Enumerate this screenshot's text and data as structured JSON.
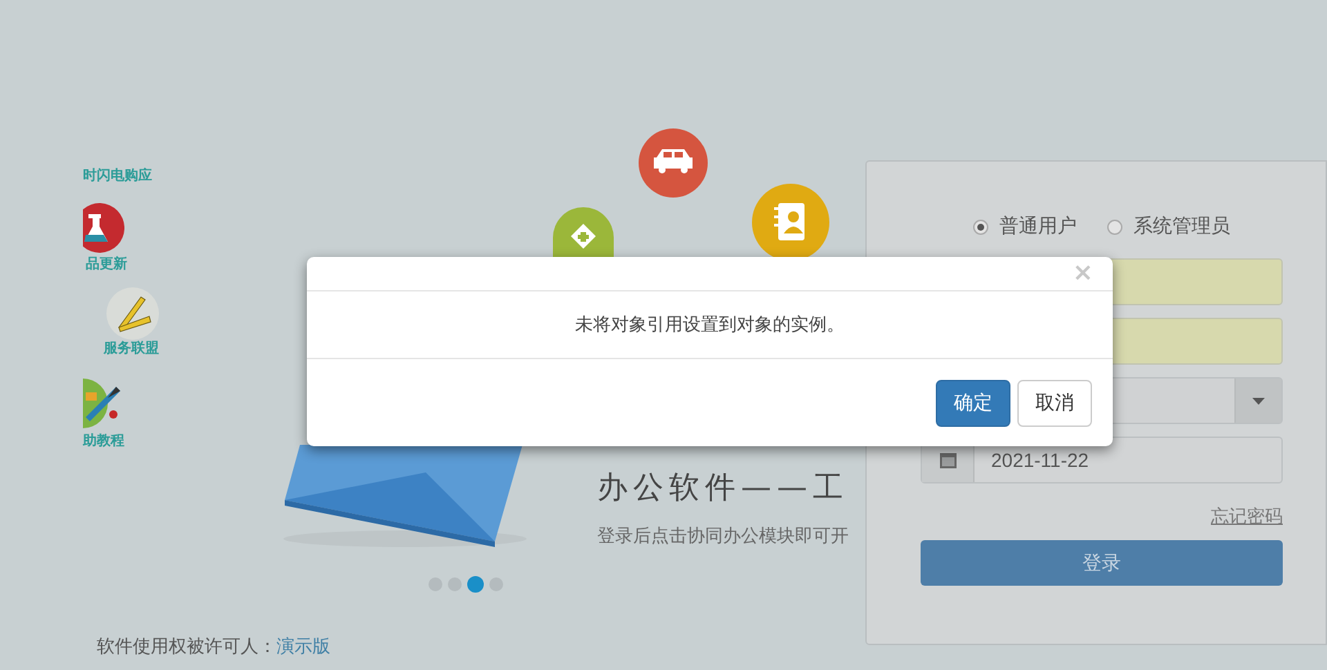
{
  "banner": {
    "side_labels": [
      "时闪电购应",
      "品更新",
      "服务联盟",
      "助教程"
    ],
    "headline": "办公软件——工",
    "subtitle": "登录后点击协同办公模块即可开",
    "dots": [
      {
        "selected": false
      },
      {
        "selected": false
      },
      {
        "selected": true
      },
      {
        "selected": false
      }
    ]
  },
  "login": {
    "roles": [
      {
        "label": "普通用户",
        "selected": true
      },
      {
        "label": "系统管理员",
        "selected": false
      }
    ],
    "date": "2021-11-22",
    "forgot_link": "忘记密码",
    "submit": "登录"
  },
  "license": {
    "label": "软件使用权被许可人：",
    "value": "演示版"
  },
  "dialog": {
    "close": "×",
    "message": "未将对象引用设置到对象的实例。",
    "buttons": [
      {
        "label": "确定",
        "kind": "primary"
      },
      {
        "label": "取消",
        "kind": "default"
      }
    ]
  }
}
